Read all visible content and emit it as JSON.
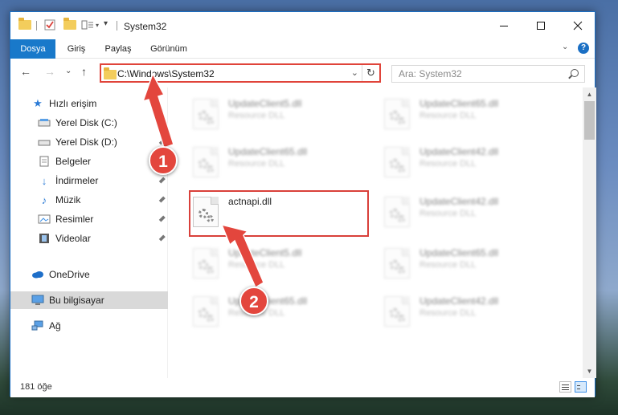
{
  "window": {
    "title": "System32",
    "minimize_icon": "minimize-icon",
    "maximize_icon": "maximize-icon",
    "close_icon": "close-icon"
  },
  "ribbon": {
    "tabs": [
      {
        "label": "Dosya",
        "active": true
      },
      {
        "label": "Giriş",
        "active": false
      },
      {
        "label": "Paylaş",
        "active": false
      },
      {
        "label": "Görünüm",
        "active": false
      }
    ],
    "expand_glyph": "⌄",
    "help_glyph": "?"
  },
  "nav": {
    "back_glyph": "←",
    "forward_glyph": "→",
    "recent_glyph": "⌄",
    "up_glyph": "↑",
    "address": "C:\\Windows\\System32",
    "dropdown_glyph": "⌄",
    "refresh_glyph": "↻",
    "search_placeholder": "Ara: System32"
  },
  "sidebar": {
    "items": [
      {
        "label": "Hızlı erişim",
        "icon": "star-icon",
        "pinned": false
      },
      {
        "label": "Yerel Disk (C:)",
        "icon": "drive-icon",
        "pinned": true
      },
      {
        "label": "Yerel Disk (D:)",
        "icon": "drive-icon",
        "pinned": true
      },
      {
        "label": "Belgeler",
        "icon": "document-icon",
        "pinned": true
      },
      {
        "label": "İndirmeler",
        "icon": "download-icon",
        "pinned": true
      },
      {
        "label": "Müzik",
        "icon": "music-icon",
        "pinned": true
      },
      {
        "label": "Resimler",
        "icon": "picture-icon",
        "pinned": true
      },
      {
        "label": "Videolar",
        "icon": "video-icon",
        "pinned": true
      },
      {
        "label": "OneDrive",
        "icon": "cloud-icon",
        "pinned": false
      },
      {
        "label": "Bu bilgisayar",
        "icon": "computer-icon",
        "pinned": false,
        "selected": true
      },
      {
        "label": "Ağ",
        "icon": "network-icon",
        "pinned": false
      }
    ]
  },
  "files": {
    "left_column": [
      {
        "name": "UpdateClient5.dll",
        "type": "Resource DLL",
        "blurred": true
      },
      {
        "name": "UpdateClient65.dll",
        "type": "Resource DLL",
        "blurred": true
      },
      {
        "name": "actnapi.dll",
        "type": "",
        "blurred": false,
        "highlighted": true
      },
      {
        "name": "UpdateClient5.dll",
        "type": "Resource DLL",
        "blurred": true
      },
      {
        "name": "UpdateClient65.dll",
        "type": "Resource DLL",
        "blurred": true
      }
    ],
    "right_column": [
      {
        "name": "UpdateClient65.dll",
        "type": "Resource DLL",
        "blurred": true
      },
      {
        "name": "UpdateClient42.dll",
        "type": "Resource DLL",
        "blurred": true
      },
      {
        "name": "UpdateClient42.dll",
        "type": "Resource DLL",
        "blurred": true
      },
      {
        "name": "UpdateClient65.dll",
        "type": "Resource DLL",
        "blurred": true
      },
      {
        "name": "UpdateClient42.dll",
        "type": "Resource DLL",
        "blurred": true
      }
    ]
  },
  "status": {
    "item_count": "181 öğe"
  },
  "callouts": [
    {
      "number": "1",
      "color": "#e3463d"
    },
    {
      "number": "2",
      "color": "#e3463d"
    }
  ],
  "colors": {
    "accent": "#1979ca",
    "highlight": "#d9403a"
  }
}
